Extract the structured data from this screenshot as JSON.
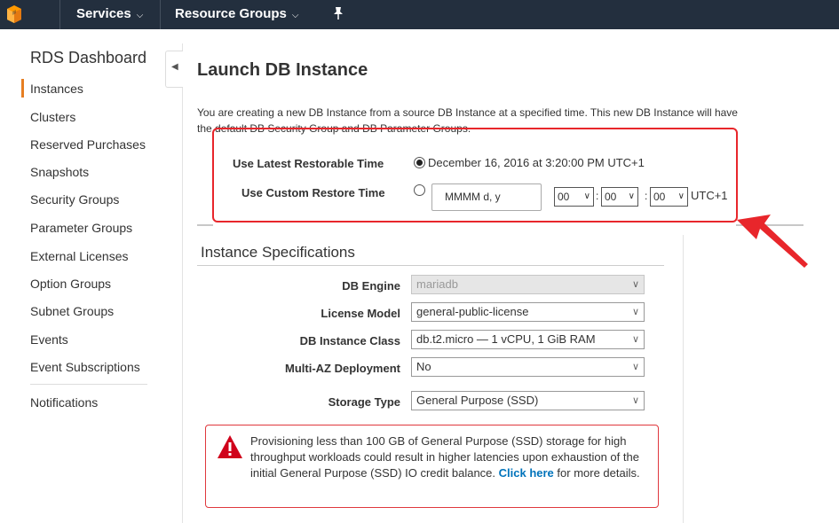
{
  "nav": {
    "services": "Services",
    "resource_groups": "Resource Groups"
  },
  "sidebar": {
    "title": "RDS Dashboard",
    "items": [
      {
        "label": "Instances",
        "active": true
      },
      {
        "label": "Clusters"
      },
      {
        "label": "Reserved Purchases"
      },
      {
        "label": "Snapshots"
      },
      {
        "label": "Security Groups"
      },
      {
        "label": "Parameter Groups"
      },
      {
        "label": "External Licenses"
      },
      {
        "label": "Option Groups"
      },
      {
        "label": "Subnet Groups"
      },
      {
        "label": "Events"
      },
      {
        "label": "Event Subscriptions"
      },
      {
        "label": "Notifications"
      }
    ]
  },
  "main": {
    "title": "Launch DB Instance",
    "intro_line1": "You are creating a new DB Instance from a source DB Instance at a specified time. This new DB Instance will have",
    "intro_line2_start": "the ",
    "intro_line2_strike": "default DB Security Group and DB Parameter Groups.",
    "restore": {
      "latest_label": "Use Latest Restorable Time",
      "latest_value": "December 16, 2016 at 3:20:00 PM UTC+1",
      "custom_label": "Use Custom Restore Time",
      "date_placeholder": "MMMM d, y",
      "hour": "00",
      "minute": "00",
      "second": "00",
      "timezone": "UTC+1",
      "selected": "latest"
    },
    "specs": {
      "title": "Instance Specifications",
      "fields": [
        {
          "label": "DB Engine",
          "value": "mariadb",
          "disabled": true
        },
        {
          "label": "License Model",
          "value": "general-public-license"
        },
        {
          "label": "DB Instance Class",
          "value": "db.t2.micro — 1 vCPU, 1 GiB RAM"
        },
        {
          "label": "Multi-AZ Deployment",
          "value": "No"
        },
        {
          "label": "Storage Type",
          "value": "General Purpose (SSD)"
        }
      ]
    },
    "warning": {
      "text": "Provisioning less than 100 GB of General Purpose (SSD) storage for high throughput workloads could result in higher latencies upon exhaustion of the initial General Purpose (SSD) IO credit balance.",
      "link": "Click here",
      "suffix": "for more details."
    }
  },
  "colors": {
    "topbar": "#232f3e",
    "accent": "#e67e22",
    "highlight": "#e8262b",
    "link": "#0073bb"
  }
}
